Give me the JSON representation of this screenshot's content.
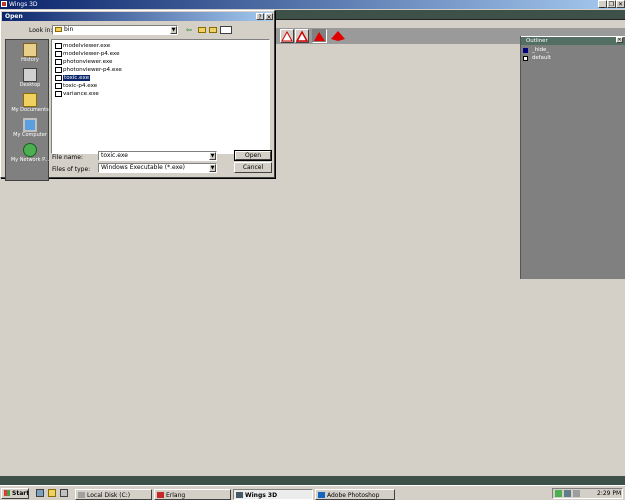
{
  "main_window": {
    "title": "Wings 3D",
    "controls": [
      "_",
      "❐",
      "✕"
    ],
    "outliner": {
      "title": "Outliner",
      "items": [
        {
          "label": "_hide_"
        },
        {
          "label": "default"
        }
      ]
    }
  },
  "dialog": {
    "title": "Open",
    "title_buttons": [
      "?",
      "✕"
    ],
    "look_in_label": "Look in:",
    "look_in_value": "bin",
    "places": [
      {
        "label": "History",
        "icon": "history-icon"
      },
      {
        "label": "Desktop",
        "icon": "desktop-icon"
      },
      {
        "label": "My Documents",
        "icon": "folder-icon"
      },
      {
        "label": "My Computer",
        "icon": "computer-icon"
      },
      {
        "label": "My Network P...",
        "icon": "network-icon"
      }
    ],
    "files": [
      {
        "name": "modelviewer.exe",
        "selected": false
      },
      {
        "name": "modelviewer-p4.exe",
        "selected": false
      },
      {
        "name": "photonviewer.exe",
        "selected": false
      },
      {
        "name": "photonviewer-p4.exe",
        "selected": false
      },
      {
        "name": "toxic.exe",
        "selected": true
      },
      {
        "name": "toxic-p4.exe",
        "selected": false
      },
      {
        "name": "variance.exe",
        "selected": false
      }
    ],
    "file_name_label": "File name:",
    "file_name_value": "toxic.exe",
    "file_type_label": "Files of type:",
    "file_type_value": "Windows Executable (*.exe)",
    "open_label": "Open",
    "cancel_label": "Cancel"
  },
  "taskbar": {
    "start_label": "Start",
    "tasks": [
      {
        "label": "Local Disk (C:)",
        "active": false
      },
      {
        "label": "Erlang",
        "active": false
      },
      {
        "label": "Wings 3D",
        "active": true
      },
      {
        "label": "Adobe Photoshop",
        "active": false
      }
    ],
    "clock": "2:29 PM"
  }
}
